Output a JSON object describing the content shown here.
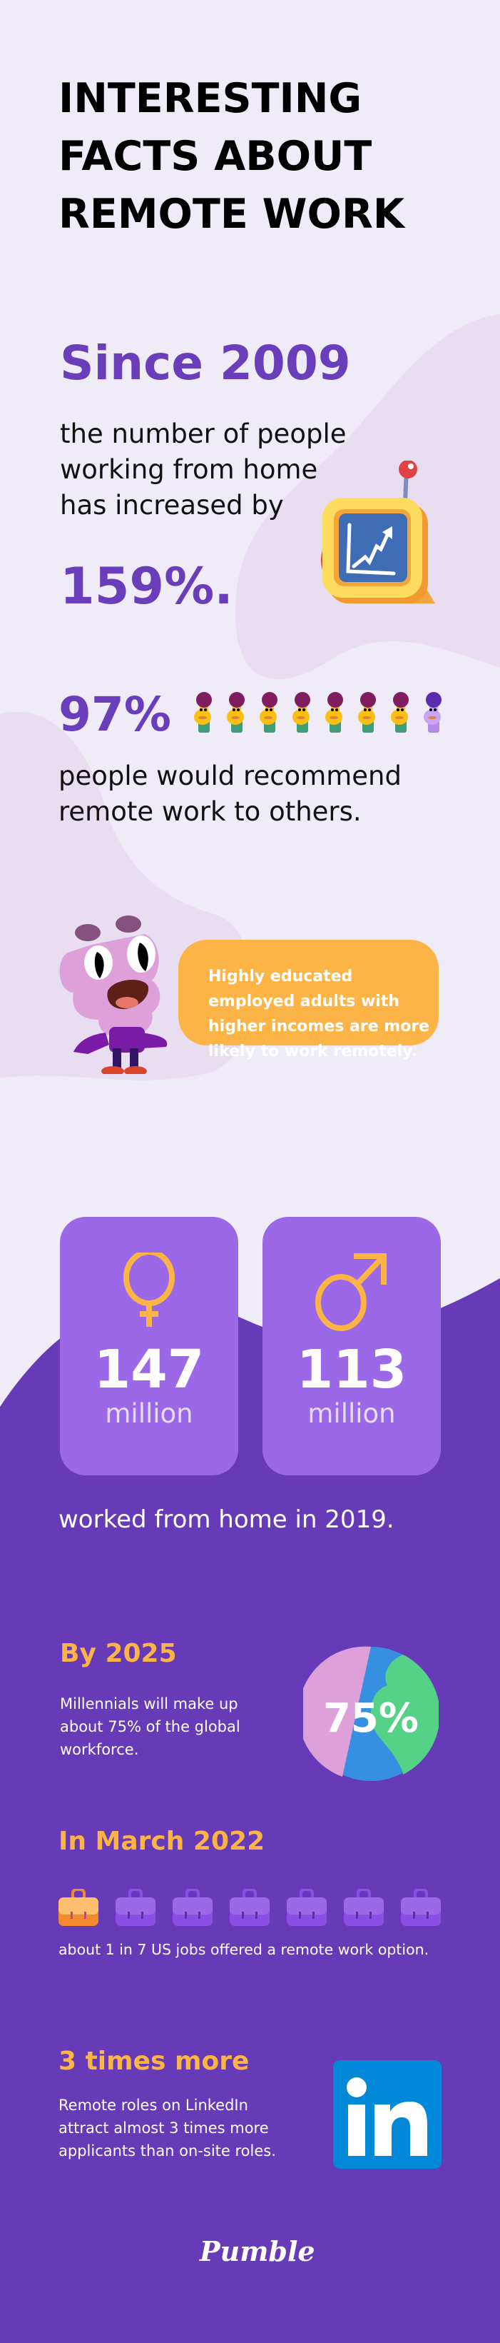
{
  "title": {
    "lines": [
      "INTERESTING",
      "FACTS ABOUT",
      "REMOTE WORK"
    ]
  },
  "fact_growth": {
    "heading": "Since 2009",
    "lines": [
      "the number of people",
      "working from home",
      "has increased by"
    ],
    "value": "159%.",
    "icon": "rising-chart-icon"
  },
  "fact_recommend": {
    "value": "97%",
    "people_icons_total": 8,
    "people_icons_highlighted": 7,
    "lines": [
      "people would recommend",
      "remote work to others."
    ]
  },
  "fact_education": {
    "bubble_lines": [
      "Highly educated",
      "employed adults with",
      "higher incomes are more",
      "likely to work remotely."
    ],
    "character": "monster-character"
  },
  "fact_gender": {
    "cards": [
      {
        "icon": "female-symbol-icon",
        "value": "147",
        "unit": "million"
      },
      {
        "icon": "male-symbol-icon",
        "value": "113",
        "unit": "million"
      }
    ],
    "caption": "worked from home in 2019."
  },
  "fact_millennials": {
    "heading": "By 2025",
    "lines": [
      "Millennials will make up",
      "about 75% of the global",
      "workforce."
    ],
    "globe_label": "75%",
    "share_percent": 75
  },
  "fact_jobs": {
    "heading": "In March 2022",
    "bags_total": 7,
    "bags_highlighted": 1,
    "caption": "about 1 in 7 US jobs offered a remote work option."
  },
  "fact_linkedin": {
    "heading": "3 times more",
    "lines": [
      "Remote roles on LinkedIn",
      "attract almost 3 times more",
      "applicants than on-site roles."
    ],
    "logo_text": "in"
  },
  "footer": {
    "brand": "Pumble"
  },
  "colors": {
    "background_light": "#efebf7",
    "blob_light": "#e8ddf1",
    "background_dark": "#673ab7",
    "purple_text": "#6a3dbb",
    "accent_orange": "#fdb446",
    "card_purple": "#9b69e8",
    "linkedin_blue": "#0288d9"
  }
}
